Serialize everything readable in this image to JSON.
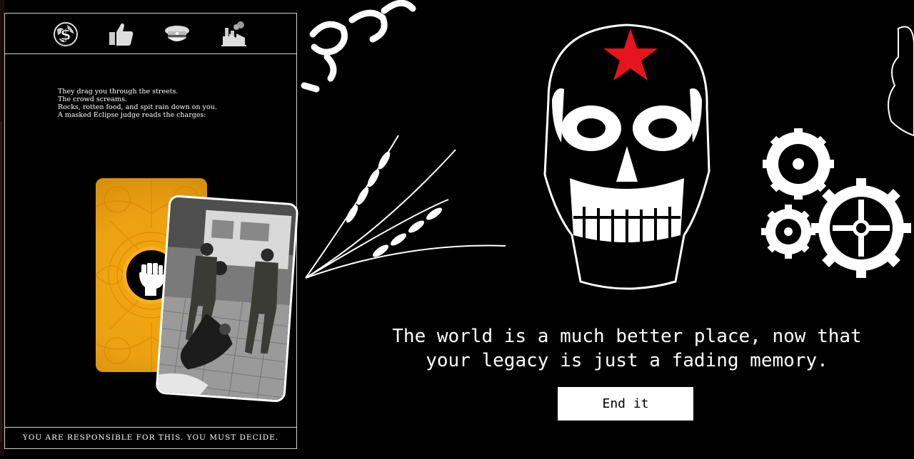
{
  "stats": [
    {
      "name": "money",
      "icon": "money-globe-icon"
    },
    {
      "name": "people",
      "icon": "thumbs-up-icon"
    },
    {
      "name": "military",
      "icon": "officer-cap-icon"
    },
    {
      "name": "industry",
      "icon": "factory-icon"
    }
  ],
  "story": {
    "lines": [
      "They drag you through the streets.",
      "The crowd screams.",
      "Rocks, rotten food, and spit rain down on you.",
      "A masked Eclipse judge reads the charges:"
    ]
  },
  "cards": {
    "faction_icon": "raised-fist-icon",
    "event_image": "soldiers-dragging-person-photo"
  },
  "footer": {
    "text": "YOU ARE RESPONSIBLE FOR THIS. YOU MUST DECIDE."
  },
  "ending": {
    "line1": "The world is a much better place, now that",
    "line2": "your legacy is just a fading memory.",
    "button": "End it"
  },
  "colors": {
    "card_accent": "#f2a30f",
    "star": "#e8141c",
    "background": "#000000"
  }
}
